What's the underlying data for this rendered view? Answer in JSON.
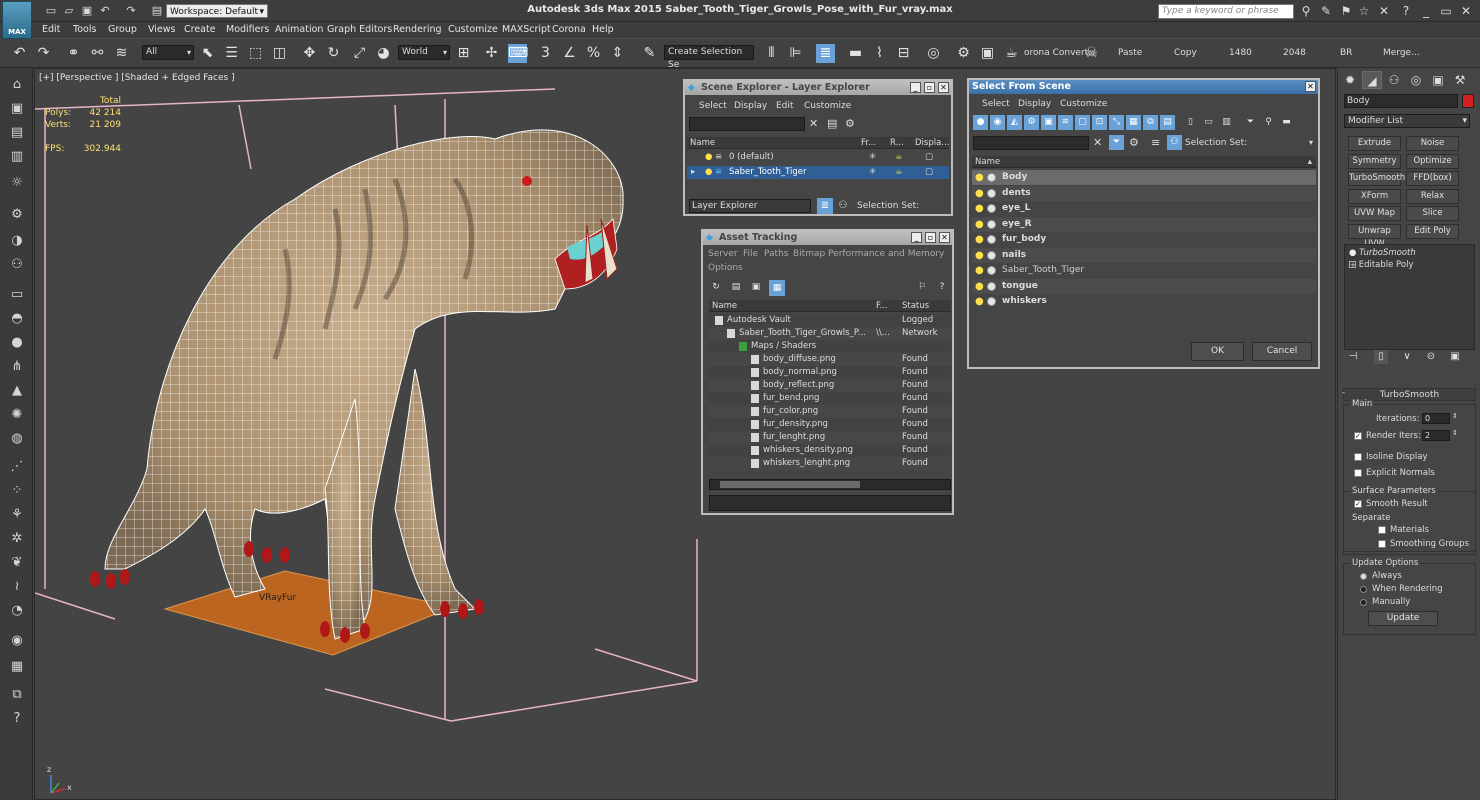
{
  "app": {
    "title": "Autodesk 3ds Max  2015    Saber_Tooth_Tiger_Growls_Pose_with_Fur_vray.max",
    "logo_text": "MAX",
    "workspace_label": "Workspace: Default",
    "search_placeholder": "Type a keyword or phrase"
  },
  "menu": [
    "Edit",
    "Tools",
    "Group",
    "Views",
    "Create",
    "Modifiers",
    "Animation",
    "Graph Editors",
    "Rendering",
    "Customize",
    "MAXScript",
    "Corona",
    "Help"
  ],
  "toolbar": {
    "filter": "All",
    "coord_system": "World",
    "selection_set": "Create Selection Se",
    "corona_convert": "orona Convert",
    "paste": "Paste",
    "copy": "Copy",
    "width": "1480",
    "height": "2048",
    "br": "BR",
    "merge": "Merge..."
  },
  "viewport": {
    "label": "[+] [Perspective ] [Shaded + Edged Faces ]",
    "stats_total": "Total",
    "polys_label": "Polys:",
    "polys_value": "42 214",
    "verts_label": "Verts:",
    "verts_value": "21 209",
    "fps_label": "FPS:",
    "fps_value": "302.944",
    "vrayfur_label": "VRayFur",
    "axis_z": "z",
    "axis_x": "x"
  },
  "layer_explorer": {
    "title": "Scene Explorer - Layer Explorer",
    "menus": [
      "Select",
      "Display",
      "Edit",
      "Customize"
    ],
    "col_name": "Name",
    "col_fr": "Fr...",
    "col_r": "R...",
    "col_disp": "Displa...",
    "rows": [
      {
        "name": "0 (default)"
      },
      {
        "name": "Saber_Tooth_Tiger"
      }
    ],
    "footer_dropdown": "Layer Explorer",
    "selection_set": "Selection Set:"
  },
  "asset_tracking": {
    "title": "Asset Tracking",
    "menus": [
      "Server",
      "File",
      "Paths",
      "Bitmap Performance and Memory"
    ],
    "menu_options": "Options",
    "col_name": "Name",
    "col_f": "F...",
    "col_status": "Status",
    "rows": [
      {
        "name": "Autodesk Vault",
        "f": "",
        "status": "Logged Out (",
        "indent": 0
      },
      {
        "name": "Saber_Tooth_Tiger_Growls_P...",
        "f": "\\\\...",
        "status": "Network Path",
        "indent": 1
      },
      {
        "name": "Maps / Shaders",
        "f": "",
        "status": "",
        "indent": 2
      },
      {
        "name": "body_diffuse.png",
        "f": "",
        "status": "Found",
        "indent": 3
      },
      {
        "name": "body_normal.png",
        "f": "",
        "status": "Found",
        "indent": 3
      },
      {
        "name": "body_reflect.png",
        "f": "",
        "status": "Found",
        "indent": 3
      },
      {
        "name": "fur_bend.png",
        "f": "",
        "status": "Found",
        "indent": 3
      },
      {
        "name": "fur_color.png",
        "f": "",
        "status": "Found",
        "indent": 3
      },
      {
        "name": "fur_density.png",
        "f": "",
        "status": "Found",
        "indent": 3
      },
      {
        "name": "fur_lenght.png",
        "f": "",
        "status": "Found",
        "indent": 3
      },
      {
        "name": "whiskers_density.png",
        "f": "",
        "status": "Found",
        "indent": 3
      },
      {
        "name": "whiskers_lenght.png",
        "f": "",
        "status": "Found",
        "indent": 3
      }
    ]
  },
  "select_from_scene": {
    "title": "Select From Scene",
    "menus": [
      "Select",
      "Display",
      "Customize"
    ],
    "selection_set": "Selection Set:",
    "col_name": "Name",
    "rows": [
      "Body",
      "dents",
      "eye_L",
      "eye_R",
      "fur_body",
      "nails",
      "Saber_Tooth_Tiger",
      "tongue",
      "whiskers"
    ],
    "ok": "OK",
    "cancel": "Cancel"
  },
  "command_panel": {
    "object_name": "Body",
    "object_color": "#d42020",
    "modifier_list": "Modifier List",
    "modifier_buttons": [
      "Extrude",
      "Noise",
      "Symmetry",
      "Optimize",
      "TurboSmooth",
      "FFD(box)",
      "XForm",
      "Relax",
      "UVW Map",
      "Slice",
      "Unwrap UVW",
      "Edit Poly"
    ],
    "stack": [
      "TurboSmooth",
      "Editable Poly"
    ],
    "turbosmooth": {
      "title": "TurboSmooth",
      "main": "Main",
      "iterations_label": "Iterations:",
      "iterations_value": "0",
      "render_iters_label": "Render Iters:",
      "render_iters_value": "2",
      "isoline": "Isoline Display",
      "explicit_normals": "Explicit Normals",
      "surface_params": "Surface Parameters",
      "smooth_result": "Smooth Result",
      "separate": "Separate",
      "materials": "Materials",
      "smoothing_groups": "Smoothing Groups",
      "update_options": "Update Options",
      "always": "Always",
      "when_rendering": "When Rendering",
      "manually": "Manually",
      "update_button": "Update"
    }
  }
}
